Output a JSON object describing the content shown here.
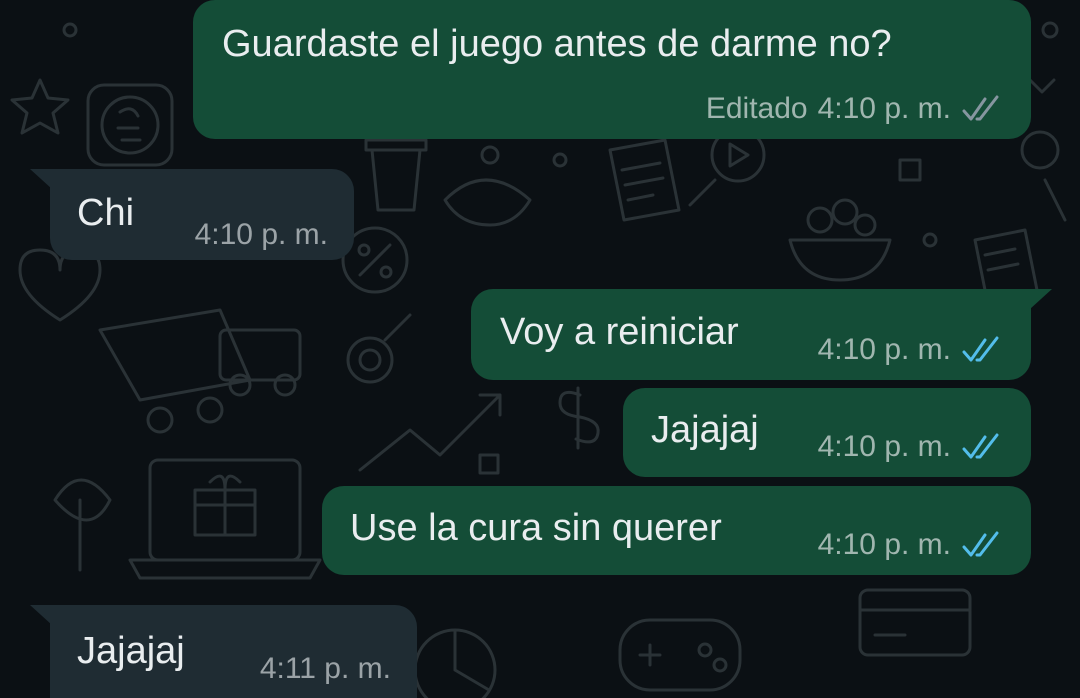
{
  "theme": {
    "outgoing_bubble": "#144d37",
    "incoming_bubble": "#1f2c33",
    "read_tick_color": "#53bdeb",
    "delivered_tick_color": "#8696a0",
    "background": "#0b1014"
  },
  "messages": [
    {
      "direction": "outgoing",
      "text": "Guardaste el juego antes de darme no?",
      "edited_label": "Editado",
      "time": "4:10 p. m.",
      "status": "delivered",
      "status_icon": "double-check-icon"
    },
    {
      "direction": "incoming",
      "text": "Chi",
      "time": "4:10 p. m."
    },
    {
      "direction": "outgoing",
      "text": "Voy a reiniciar",
      "time": "4:10 p. m.",
      "status": "read",
      "status_icon": "double-check-icon"
    },
    {
      "direction": "outgoing",
      "text": "Jajajaj",
      "time": "4:10 p. m.",
      "status": "read",
      "status_icon": "double-check-icon"
    },
    {
      "direction": "outgoing",
      "text": "Use la cura sin querer",
      "time": "4:10 p. m.",
      "status": "read",
      "status_icon": "double-check-icon"
    },
    {
      "direction": "incoming",
      "text": "Jajajaj",
      "time": "4:11 p. m."
    }
  ]
}
